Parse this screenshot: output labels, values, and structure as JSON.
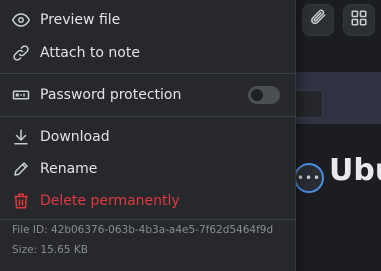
{
  "menu": {
    "items": {
      "preview": {
        "label": "Preview file",
        "icon": "eye-icon"
      },
      "attach": {
        "label": "Attach to note",
        "icon": "link-icon"
      },
      "password": {
        "label": "Password protection",
        "icon": "password-icon",
        "enabled": false
      },
      "download": {
        "label": "Download",
        "icon": "download-icon"
      },
      "rename": {
        "label": "Rename",
        "icon": "pencil-icon"
      },
      "delete": {
        "label": "Delete permanently",
        "icon": "trash-icon"
      }
    },
    "file_id": "File ID: 42b06376-063b-4b3a-a4e5-7f62d5464f9d",
    "size": "Size: 15.65 KB"
  },
  "background": {
    "title_fragment": "Ubu",
    "more_button": "•••"
  },
  "colors": {
    "menu_bg": "#26282c",
    "text": "#e3e4e6",
    "danger": "#e0393e",
    "muted": "#8a8d92",
    "accent": "#4a90e2",
    "toggle_off": "#4b4e53"
  }
}
